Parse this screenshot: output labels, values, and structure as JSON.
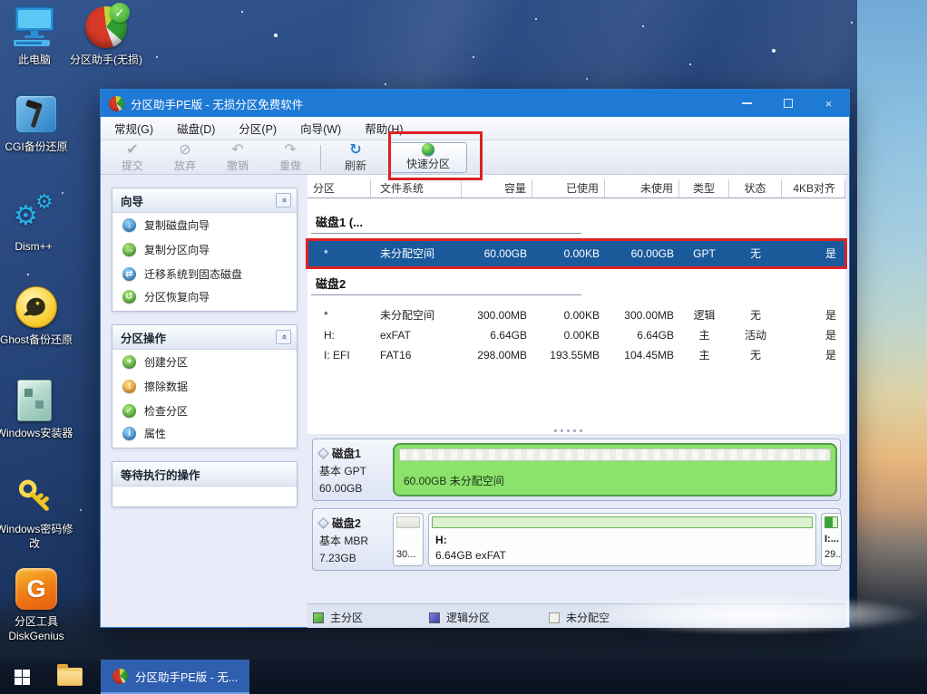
{
  "colors": {
    "titlebar_blue": "#1e7ad5",
    "selection_blue": "#1a5a9b",
    "annotation_red": "#dd2222",
    "primary_partition_green": "#4fae45",
    "logical_partition_blue": "#4c4fc0",
    "unallocated_gray": "#f2f2ea",
    "disk1_bar_green": "#8ce26b"
  },
  "desktop": {
    "icons": [
      {
        "name": "this-pc",
        "label": "此电脑"
      },
      {
        "name": "partition-assistant",
        "label": "分区助手(无损)"
      },
      {
        "name": "cgi-backup-restore",
        "label": "CGI备份还原"
      },
      {
        "name": "dism-plus-plus",
        "label": "Dism++"
      },
      {
        "name": "ghost-backup-restore",
        "label": "Ghost备份还原"
      },
      {
        "name": "windows-installer",
        "label": "Windows安装器"
      },
      {
        "name": "windows-password-reset",
        "label": "Windows密码修改"
      },
      {
        "name": "diskgenius",
        "label": "分区工具DiskGenius"
      }
    ]
  },
  "window": {
    "title": "分区助手PE版 - 无损分区免费软件",
    "menu": [
      "常规(G)",
      "磁盘(D)",
      "分区(P)",
      "向导(W)",
      "帮助(H)"
    ],
    "toolbar": [
      {
        "label": "提交",
        "glyph": "✔"
      },
      {
        "label": "放弃",
        "glyph": "⊘"
      },
      {
        "label": "撤销",
        "glyph": "↶"
      },
      {
        "label": "重做",
        "glyph": "↷"
      },
      {
        "label": "刷新",
        "glyph": "↻"
      },
      {
        "label": "快速分区"
      }
    ],
    "sidebar": {
      "panels": [
        {
          "title": "向导",
          "items": [
            {
              "label": "复制磁盘向导",
              "glyph": "↓"
            },
            {
              "label": "复制分区向导",
              "glyph": "→"
            },
            {
              "label": "迁移系统到固态磁盘",
              "glyph": "⇄"
            },
            {
              "label": "分区恢复向导",
              "glyph": "↺"
            }
          ]
        },
        {
          "title": "分区操作",
          "items": [
            {
              "label": "创建分区",
              "glyph": "+"
            },
            {
              "label": "擦除数据",
              "glyph": "!"
            },
            {
              "label": "检查分区",
              "glyph": "✓"
            },
            {
              "label": "属性",
              "glyph": "i"
            }
          ]
        },
        {
          "title": "等待执行的操作",
          "items": []
        }
      ]
    },
    "table": {
      "columns": [
        "分区",
        "文件系统",
        "容量",
        "已使用",
        "未使用",
        "类型",
        "状态",
        "4KB对齐"
      ],
      "disk1_group": "磁盘1 (...",
      "disk1_rows": [
        {
          "selected": true,
          "cells": [
            "*",
            "未分配空间",
            "60.00GB",
            "0.00KB",
            "60.00GB",
            "GPT",
            "无",
            "是"
          ]
        }
      ],
      "disk2_group": "磁盘2",
      "disk2_rows": [
        {
          "cells": [
            "*",
            "未分配空间",
            "300.00MB",
            "0.00KB",
            "300.00MB",
            "逻辑",
            "无",
            "是"
          ]
        },
        {
          "cells": [
            "H:",
            "exFAT",
            "6.64GB",
            "0.00KB",
            "6.64GB",
            "主",
            "活动",
            "是"
          ]
        },
        {
          "cells": [
            "I: EFI",
            "FAT16",
            "298.00MB",
            "193.55MB",
            "104.45MB",
            "主",
            "无",
            "是"
          ]
        }
      ]
    },
    "disk_graph": {
      "disk1": {
        "name": "磁盘1",
        "scheme": "基本 GPT",
        "size": "60.00GB",
        "bar_label": "60.00GB 未分配空间"
      },
      "disk2": {
        "name": "磁盘2",
        "scheme": "基本 MBR",
        "size": "7.23GB",
        "seg1_label": "30...",
        "seg2_drive": "H:",
        "seg2_label": "6.64GB exFAT",
        "seg3_drive": "I:...",
        "seg3_label": "29..."
      }
    },
    "legend": [
      {
        "label": "主分区"
      },
      {
        "label": "逻辑分区"
      },
      {
        "label": "未分配空"
      }
    ]
  },
  "taskbar": {
    "task_label": "分区助手PE版 - 无..."
  }
}
